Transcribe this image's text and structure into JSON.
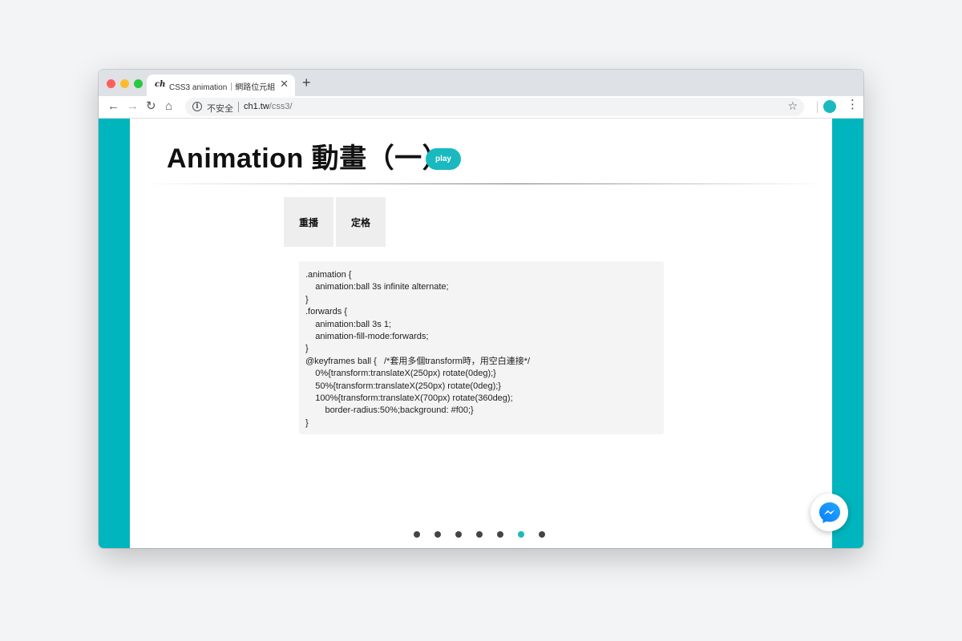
{
  "browser": {
    "tab": {
      "favicon": "ch",
      "title": "CSS3 animation｜網路位元組",
      "close_glyph": "✕"
    },
    "new_tab_glyph": "+",
    "nav": {
      "back": "←",
      "forward": "→",
      "reload": "↻",
      "home": "⌂"
    },
    "address": {
      "info_glyph": "i",
      "security_label": "不安全",
      "host": "ch1.tw",
      "path": "/css3/"
    },
    "bookmark_glyph": "☆",
    "menu_glyph": "⋮",
    "traffic_lights": [
      "#ff5f57",
      "#febc2e",
      "#28c840"
    ],
    "profile_color": "#19b9bf"
  },
  "page": {
    "title": "Animation 動畫（一）",
    "play_label": "play",
    "buttons": {
      "replay": "重播",
      "freeze": "定格"
    },
    "code_lines": [
      ".animation {",
      "    animation:ball 3s infinite alternate;",
      "}",
      ".forwards {",
      "    animation:ball 3s 1;",
      "    animation-fill-mode:forwards;",
      "}",
      "@keyframes ball {   /*套用多個transform時，用空白連接*/",
      "    0%{transform:translateX(250px) rotate(0deg);}",
      "    50%{transform:translateX(250px) rotate(0deg);}",
      "    100%{transform:translateX(700px) rotate(360deg);",
      "        border-radius:50%;background: #f00;}",
      "}"
    ],
    "slide_count": 7,
    "active_slide": 6,
    "accent_color": "#19b9bf",
    "rail_color": "#00b5bd"
  }
}
